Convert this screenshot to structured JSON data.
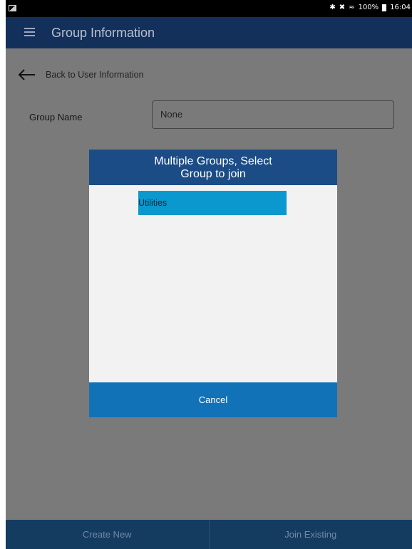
{
  "status_bar": {
    "bluetooth_icon": "bluetooth-icon",
    "mute_icon": "mute-icon",
    "wifi_icon": "wifi-icon",
    "battery": "100%",
    "time": "16:04"
  },
  "app_bar": {
    "title": "Group Information",
    "menu_icon": "hamburger-icon"
  },
  "back_link": {
    "label": "Back to User Information",
    "icon": "arrow-left-icon"
  },
  "group_name": {
    "label": "Group Name",
    "value": "None"
  },
  "dialog": {
    "title_line1": "Multiple Groups, Select",
    "title_line2": "Group to join",
    "options": [
      "Utilities"
    ],
    "cancel_label": "Cancel"
  },
  "bottom_bar": {
    "create_label": "Create New",
    "join_label": "Join Existing"
  },
  "colors": {
    "app_bar": "#13305b",
    "dialog_header": "#1c4c86",
    "selected_option": "#0a98ce",
    "cancel_button": "#1272b8",
    "bottom_bar": "#143b60"
  }
}
